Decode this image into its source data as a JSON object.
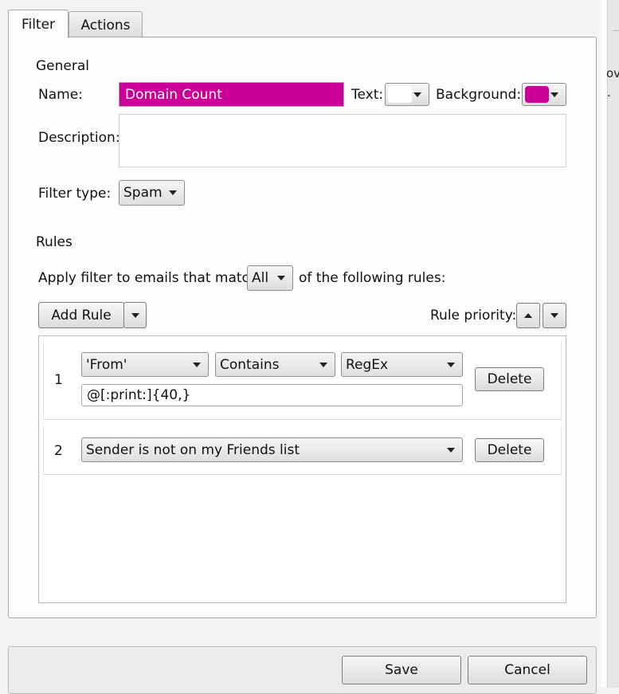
{
  "tabs": [
    {
      "label": "Filter",
      "selected": true
    },
    {
      "label": "Actions",
      "selected": false
    }
  ],
  "general": {
    "title": "General",
    "name_label": "Name:",
    "name_value": "Domain Count",
    "text_label": "Text:",
    "text_color": "#ffffff",
    "background_label": "Background:",
    "background_color": "#cc0099",
    "description_label": "Description:",
    "description_value": "",
    "filter_type_label": "Filter type:",
    "filter_type_value": "Spam"
  },
  "rules": {
    "title": "Rules",
    "apply_prefix": "Apply filter to emails that match",
    "match_value": "All",
    "apply_suffix": "of the following rules:",
    "add_rule_label": "Add Rule",
    "priority_label": "Rule priority:",
    "items": [
      {
        "number": "1",
        "field": "'From'",
        "operator": "Contains",
        "mode": "RegEx",
        "pattern": "@[:print:]{40,}",
        "delete_label": "Delete"
      },
      {
        "number": "2",
        "condition": "Sender is not on my Friends list",
        "delete_label": "Delete"
      }
    ]
  },
  "footer": {
    "save_label": "Save",
    "cancel_label": "Cancel"
  },
  "background_window": {
    "fragment_1": "ov",
    "fragment_2": "."
  }
}
